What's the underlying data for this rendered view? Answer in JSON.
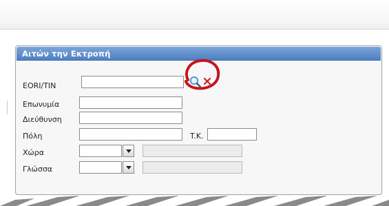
{
  "form": {
    "title": "Αιτών την Εκτροπή",
    "eori": {
      "label": "EORI/TIN",
      "value": ""
    },
    "surname": {
      "label": "Επωνυμία",
      "value": ""
    },
    "address": {
      "label": "Διεύθυνση",
      "value": ""
    },
    "city": {
      "label": "Πόλη",
      "value": ""
    },
    "postal": {
      "label": "T.K.",
      "value": ""
    },
    "country": {
      "label": "Χώρα",
      "value": "",
      "description": ""
    },
    "language": {
      "label": "Γλώσσα",
      "value": "",
      "description": ""
    }
  },
  "icons": {
    "search": "search-icon",
    "clear": "clear-x-icon",
    "highlight": "red-circle-highlight",
    "dropdown": "chevron-down-icon"
  },
  "colors": {
    "header": "#4f80c2",
    "highlight": "#c8141c",
    "clear": "#d22020"
  }
}
